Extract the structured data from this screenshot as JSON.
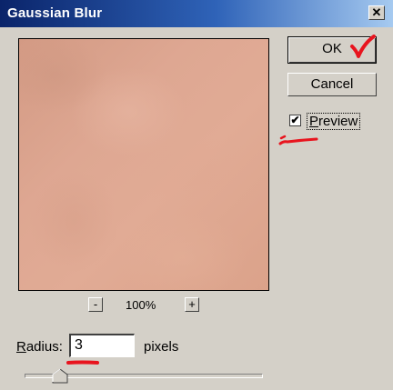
{
  "window": {
    "title": "Gaussian Blur",
    "close_glyph": "✕"
  },
  "buttons": {
    "ok_label": "OK",
    "cancel_label": "Cancel"
  },
  "preview": {
    "label": "Preview",
    "checked": true,
    "check_glyph": "✔"
  },
  "zoom": {
    "minus_label": "-",
    "plus_label": "+",
    "level": "100%"
  },
  "radius": {
    "label": "Radius:",
    "value": "3",
    "unit": "pixels",
    "slider_fraction": 0.15
  },
  "colors": {
    "title_bar": "#0a246a",
    "face": "#d4d0c8",
    "annotation_red": "#e8141e",
    "skin": "#dea792"
  }
}
